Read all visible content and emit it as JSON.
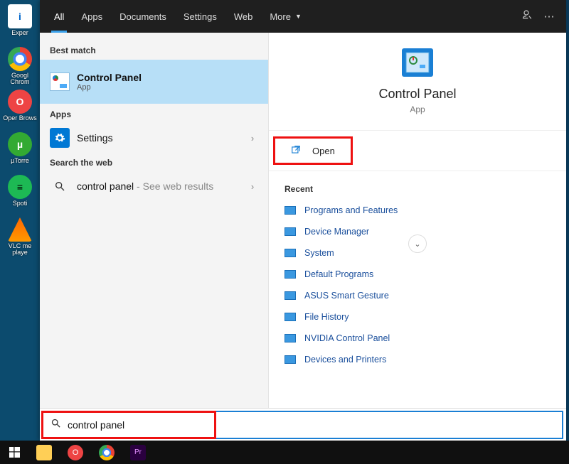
{
  "tabs": {
    "all": "All",
    "apps": "Apps",
    "documents": "Documents",
    "settings": "Settings",
    "web": "Web",
    "more": "More"
  },
  "sections": {
    "best_match": "Best match",
    "apps": "Apps",
    "search_web": "Search the web",
    "recent": "Recent"
  },
  "best": {
    "title": "Control Panel",
    "subtitle": "App"
  },
  "apps_row": {
    "title": "Settings"
  },
  "web_row": {
    "query": "control panel",
    "suffix": " - See web results"
  },
  "hero": {
    "title": "Control Panel",
    "subtitle": "App"
  },
  "actions": {
    "open": "Open"
  },
  "recent_items": [
    "Programs and Features",
    "Device Manager",
    "System",
    "Default Programs",
    "ASUS Smart Gesture",
    "File History",
    "NVIDIA Control Panel",
    "Devices and Printers"
  ],
  "search": {
    "value": "control panel"
  },
  "desktop": {
    "i0": "Exper",
    "i1": "Googl Chrom",
    "i2": "Oper Brows",
    "i3": "µTorre",
    "i4": "Spoti",
    "i5": "VLC me playe"
  }
}
